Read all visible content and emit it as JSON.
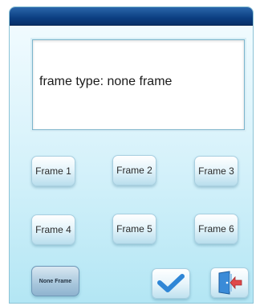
{
  "display": {
    "text": "frame type: none frame"
  },
  "frames": [
    {
      "label": "Frame 1"
    },
    {
      "label": "Frame 2"
    },
    {
      "label": "Frame 3"
    },
    {
      "label": "Frame 4"
    },
    {
      "label": "Frame 5"
    },
    {
      "label": "Frame 6"
    }
  ],
  "none_frame": {
    "label": "None Frame"
  },
  "actions": {
    "confirm_icon": "checkmark-icon",
    "exit_icon": "exit-door-icon"
  },
  "colors": {
    "title_bar": "#0c3f82",
    "confirm_accent": "#2f86d6",
    "exit_accent": "#e0484a"
  }
}
